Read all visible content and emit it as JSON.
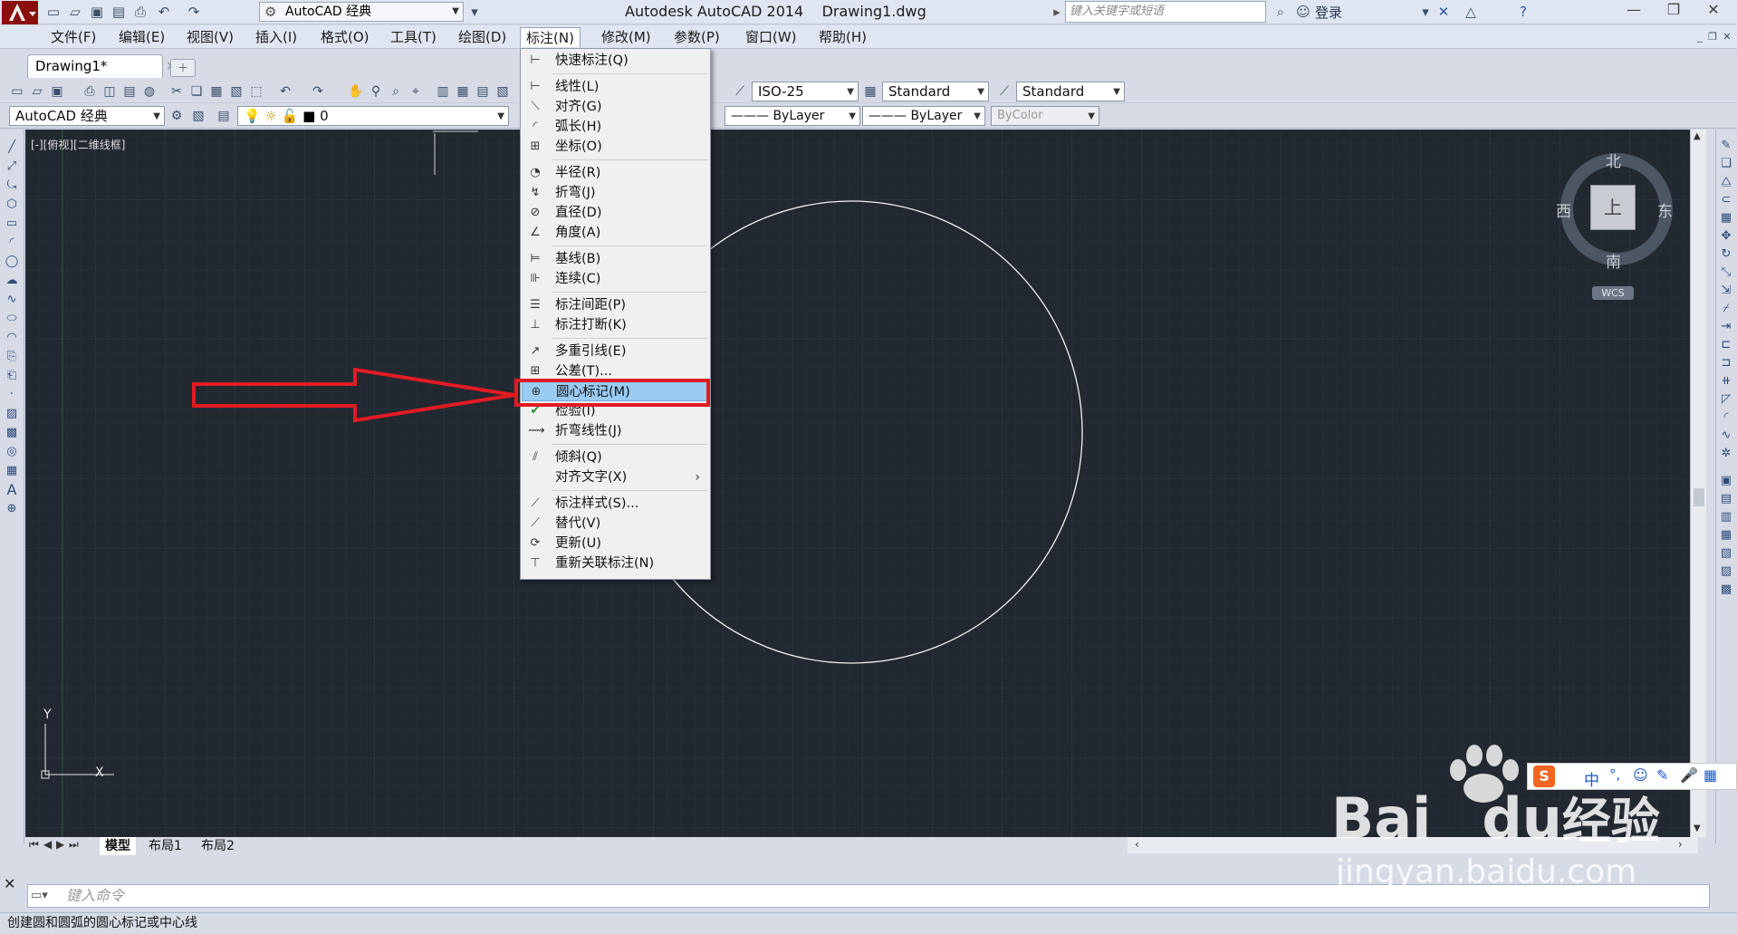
{
  "titlebar": {
    "workspace": "AutoCAD 经典",
    "app_title": "Autodesk AutoCAD 2014",
    "doc_title": "Drawing1.dwg",
    "search_placeholder": "键入关键字或短语",
    "login": "登录"
  },
  "menubar": {
    "items": [
      "文件(F)",
      "编辑(E)",
      "视图(V)",
      "插入(I)",
      "格式(O)",
      "工具(T)",
      "绘图(D)",
      "标注(N)",
      "修改(M)",
      "参数(P)",
      "窗口(W)",
      "帮助(H)"
    ]
  },
  "doc_tab": {
    "label": "Drawing1*",
    "close": "×"
  },
  "toolbar": {
    "dimstyle": "ISO-25",
    "textstyle": "Standard",
    "tablestyle": "Standard",
    "workspace2": "AutoCAD 经典",
    "layer": "0",
    "linetype": "ByLayer",
    "lineweight": "ByLayer",
    "plotstyle": "ByColor"
  },
  "viewport_label": "[-][俯视][二维线框]",
  "dimension_menu": {
    "items": [
      {
        "label": "快速标注(Q)",
        "icon": "quick-dim-icon"
      },
      {
        "label": "线性(L)",
        "icon": "linear-dim-icon"
      },
      {
        "label": "对齐(G)",
        "icon": "aligned-dim-icon"
      },
      {
        "label": "弧长(H)",
        "icon": "arc-length-icon"
      },
      {
        "label": "坐标(O)",
        "icon": "ordinate-icon"
      },
      {
        "label": "半径(R)",
        "icon": "radius-icon"
      },
      {
        "label": "折弯(J)",
        "icon": "jogged-icon"
      },
      {
        "label": "直径(D)",
        "icon": "diameter-icon"
      },
      {
        "label": "角度(A)",
        "icon": "angular-icon"
      },
      {
        "label": "基线(B)",
        "icon": "baseline-icon"
      },
      {
        "label": "连续(C)",
        "icon": "continue-icon"
      },
      {
        "label": "标注间距(P)",
        "icon": "dim-space-icon"
      },
      {
        "label": "标注打断(K)",
        "icon": "dim-break-icon"
      },
      {
        "label": "多重引线(E)",
        "icon": "multileader-icon"
      },
      {
        "label": "公差(T)...",
        "icon": "tolerance-icon"
      },
      {
        "label": "圆心标记(M)",
        "icon": "center-mark-icon"
      },
      {
        "label": "检验(I)",
        "icon": "inspect-icon"
      },
      {
        "label": "折弯线性(J)",
        "icon": "jogged-linear-icon"
      },
      {
        "label": "倾斜(Q)",
        "icon": "oblique-icon"
      },
      {
        "label": "对齐文字(X)",
        "icon": ""
      },
      {
        "label": "标注样式(S)...",
        "icon": "dim-style-icon"
      },
      {
        "label": "替代(V)",
        "icon": "override-icon"
      },
      {
        "label": "更新(U)",
        "icon": "update-icon"
      },
      {
        "label": "重新关联标注(N)",
        "icon": "reassociate-icon"
      }
    ],
    "highlighted": "圆心标记(M)"
  },
  "compass": {
    "north": "北",
    "south": "南",
    "east": "东",
    "west": "西",
    "top": "上",
    "wcs": "WCS"
  },
  "ucs": {
    "x": "X",
    "y": "Y"
  },
  "layout_tabs": [
    "模型",
    "布局1",
    "布局2"
  ],
  "command": {
    "placeholder": "键入命令"
  },
  "status_text": "创建圆和圆弧的圆心标记或中心线",
  "watermark": {
    "brand": "Bai",
    "brand2": "du",
    "cn": "经验",
    "url": "jingyan.baidu.com"
  },
  "ime": {
    "label": "中"
  },
  "colors": {
    "canvas": "#212830",
    "highlight": "#e21b23",
    "menu_hl": "#99cbf3"
  }
}
